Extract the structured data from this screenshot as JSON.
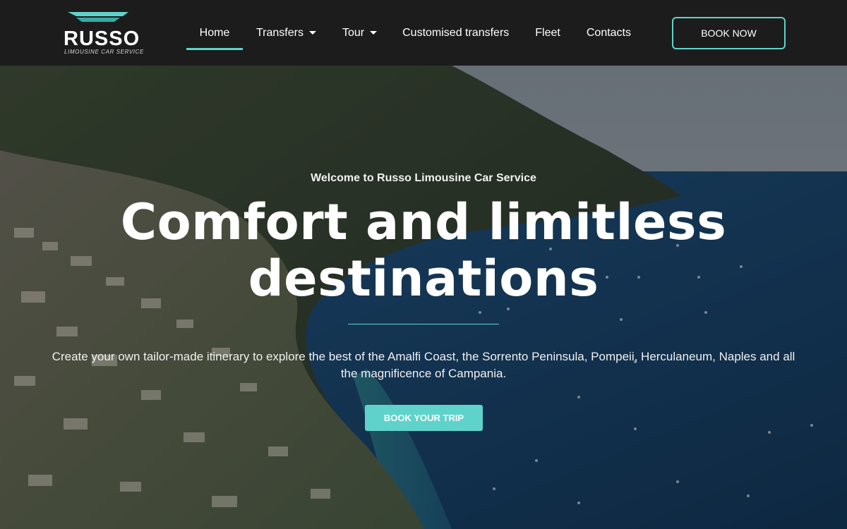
{
  "brand": {
    "name": "RUSSO",
    "tagline": "Limousine Car Service"
  },
  "nav": {
    "items": [
      {
        "label": "Home",
        "active": true
      },
      {
        "label": "Transfers",
        "dropdown": true
      },
      {
        "label": "Tour",
        "dropdown": true
      },
      {
        "label": "Customised transfers"
      },
      {
        "label": "Fleet"
      },
      {
        "label": "Contacts"
      }
    ],
    "cta_label": "BOOK NOW"
  },
  "hero": {
    "welcome": "Welcome to Russo Limousine Car Service",
    "headline_line1": "Comfort and limitless",
    "headline_line2": "destinations",
    "subtext": "Create your own tailor-made itinerary to explore the best of the Amalfi Coast, the Sorrento Peninsula, Pompeii, Herculaneum, Naples and all the magnificence of Campania.",
    "cta_label": "BOOK YOUR TRIP"
  },
  "colors": {
    "accent": "#5fd3cb",
    "header_bg": "#1c1c1c"
  }
}
